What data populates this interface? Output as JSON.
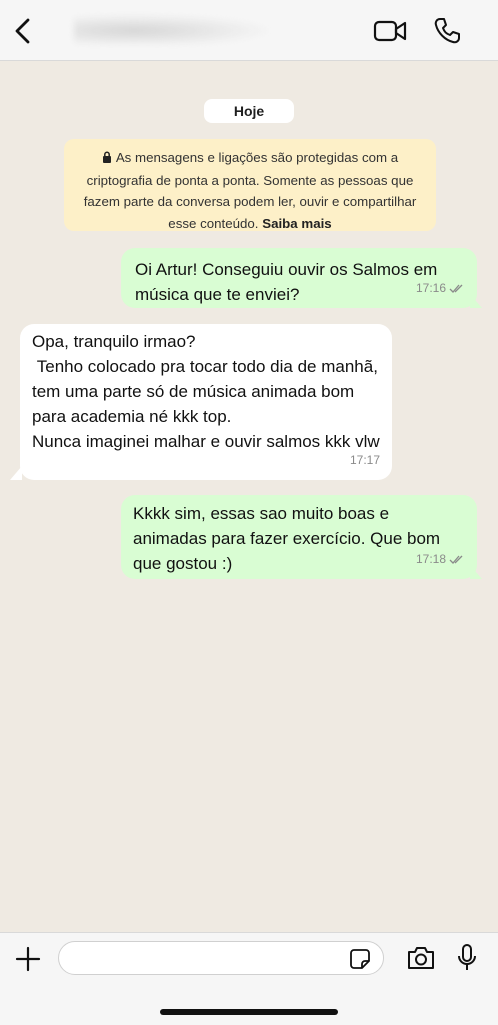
{
  "header": {
    "contact_name": "",
    "icons": [
      "back-chevron-icon",
      "video-call-icon",
      "phone-call-icon"
    ]
  },
  "chat": {
    "day_label": "Hoje",
    "encryption_notice": "As mensagens e ligações são protegidas com a criptografia de ponta a ponta. Somente as pessoas que fazem parte da conversa podem ler, ouvir e compartilhar esse conteúdo.",
    "encryption_link": "Saiba mais",
    "messages": [
      {
        "direction": "outgoing",
        "text": "Oi Artur! Conseguiu ouvir os Salmos em música que te enviei?",
        "time": "17:16",
        "status": "read"
      },
      {
        "direction": "incoming",
        "text": "Opa, tranquilo irmao?\n Tenho colocado pra tocar todo dia de manhã, tem uma parte só de música animada bom para academia né kkk top.\nNunca imaginei malhar e ouvir salmos kkk vlw",
        "time": "17:17"
      },
      {
        "direction": "outgoing",
        "text": "Kkkk sim, essas sao muito boas e animadas para fazer exercício. Que bom que gostou :)",
        "time": "17:18",
        "status": "read"
      }
    ]
  },
  "composer": {
    "placeholder": "",
    "icons": [
      "plus-icon",
      "sticker-icon",
      "camera-icon",
      "microphone-icon"
    ]
  },
  "colors": {
    "background": "#efeae2",
    "outgoing_bubble": "#d9fdd3",
    "incoming_bubble": "#ffffff",
    "notice_bubble": "#fdf0c8"
  }
}
